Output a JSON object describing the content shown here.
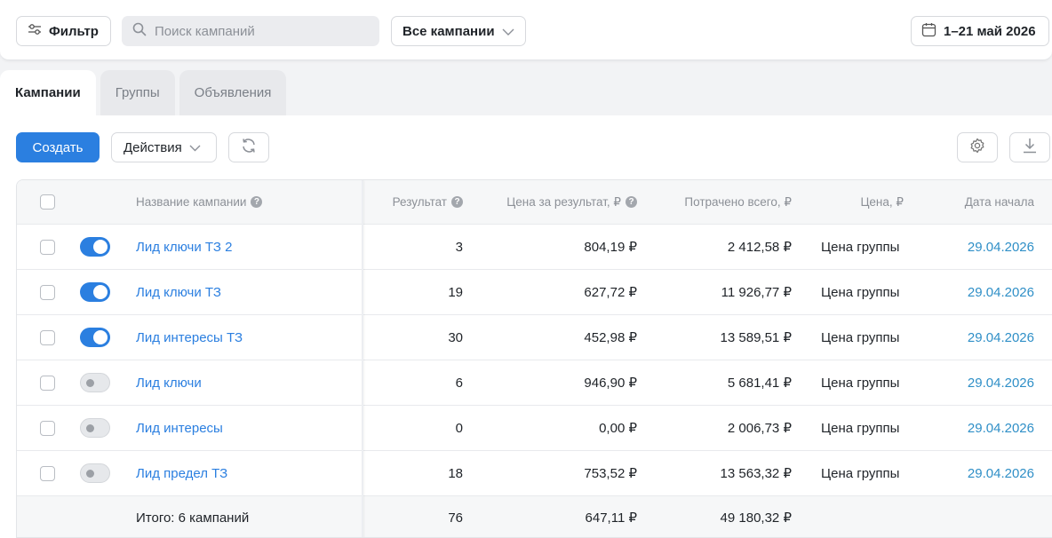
{
  "topbar": {
    "filter_label": "Фильтр",
    "search_placeholder": "Поиск кампаний",
    "campaign_select": "Все кампании",
    "date_range": "1–21 май 2026"
  },
  "tabs": [
    {
      "label": "Кампании",
      "active": true
    },
    {
      "label": "Группы",
      "active": false
    },
    {
      "label": "Объявления",
      "active": false
    }
  ],
  "toolbar": {
    "create_label": "Создать",
    "actions_label": "Действия"
  },
  "table": {
    "columns": {
      "name": "Название кампании",
      "result": "Результат",
      "price_per_result": "Цена за результат, ₽",
      "spent_total": "Потрачено всего, ₽",
      "price": "Цена, ₽",
      "start_date": "Дата начала"
    },
    "rows": [
      {
        "enabled": true,
        "name": "Лид ключи ТЗ 2",
        "result": "3",
        "price_per_result": "804,19 ₽",
        "spent": "2 412,58 ₽",
        "price": "Цена группы",
        "date": "29.04.2026"
      },
      {
        "enabled": true,
        "name": "Лид ключи ТЗ",
        "result": "19",
        "price_per_result": "627,72 ₽",
        "spent": "11 926,77 ₽",
        "price": "Цена группы",
        "date": "29.04.2026"
      },
      {
        "enabled": true,
        "name": "Лид интересы ТЗ",
        "result": "30",
        "price_per_result": "452,98 ₽",
        "spent": "13 589,51 ₽",
        "price": "Цена группы",
        "date": "29.04.2026"
      },
      {
        "enabled": false,
        "name": "Лид ключи",
        "result": "6",
        "price_per_result": "946,90 ₽",
        "spent": "5 681,41 ₽",
        "price": "Цена группы",
        "date": "29.04.2026"
      },
      {
        "enabled": false,
        "name": "Лид интересы",
        "result": "0",
        "price_per_result": "0,00 ₽",
        "spent": "2 006,73 ₽",
        "price": "Цена группы",
        "date": "29.04.2026"
      },
      {
        "enabled": false,
        "name": "Лид предел ТЗ",
        "result": "18",
        "price_per_result": "753,52 ₽",
        "spent": "13 563,32 ₽",
        "price": "Цена группы",
        "date": "29.04.2026"
      }
    ],
    "total": {
      "label": "Итого: 6 кампаний",
      "result": "76",
      "price_per_result": "647,11 ₽",
      "spent": "49 180,32 ₽"
    }
  },
  "colors": {
    "accent": "#2b7fe0",
    "link_date": "#2f8fc7"
  }
}
